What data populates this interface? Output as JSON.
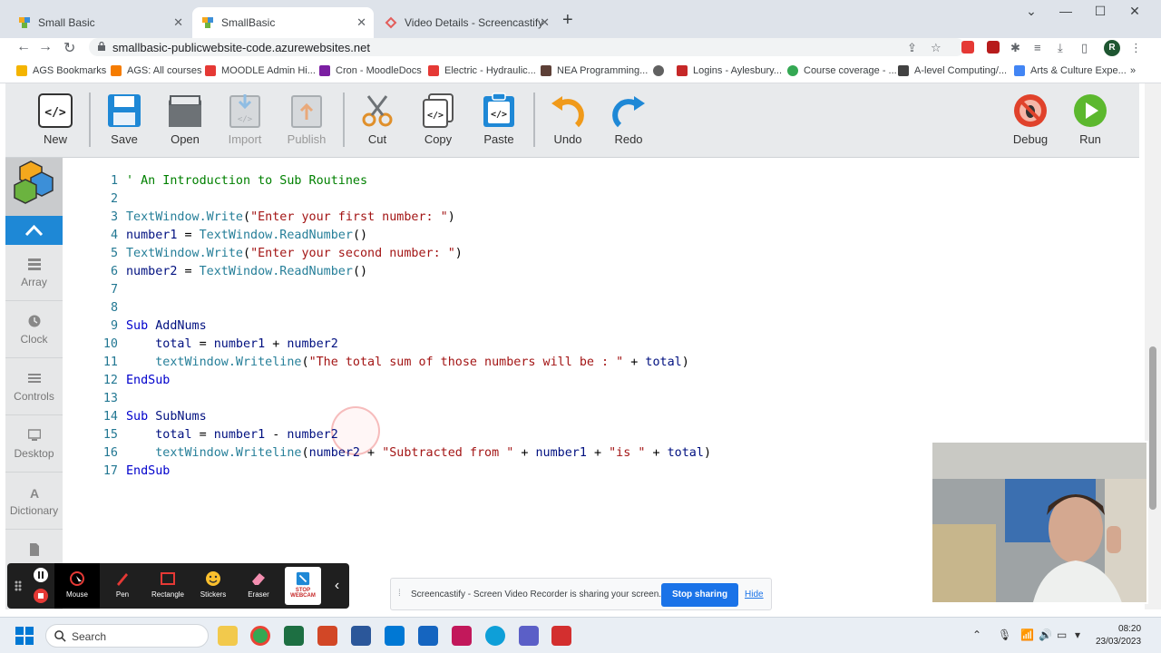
{
  "browser": {
    "tabs": [
      {
        "title": "Small Basic",
        "active": false
      },
      {
        "title": "SmallBasic",
        "active": true
      },
      {
        "title": "Video Details - Screencastify",
        "active": false
      }
    ],
    "url": "smallbasic-publicwebsite-code.azurewebsites.net",
    "profile_initial": "R",
    "bookmarks": [
      "AGS Bookmarks",
      "AGS: All courses",
      "MOODLE Admin Hi...",
      "Cron - MoodleDocs",
      "Electric - Hydraulic...",
      "NEA Programming...",
      "Logins - Aylesbury...",
      "Course coverage - ...",
      "A-level Computing/...",
      "Arts & Culture Expe..."
    ]
  },
  "ribbon": {
    "new": "New",
    "save": "Save",
    "open": "Open",
    "import": "Import",
    "publish": "Publish",
    "cut": "Cut",
    "copy": "Copy",
    "paste": "Paste",
    "undo": "Undo",
    "redo": "Redo",
    "debug": "Debug",
    "run": "Run"
  },
  "sidebar": {
    "items": [
      "Array",
      "Clock",
      "Controls",
      "Desktop",
      "Dictionary"
    ]
  },
  "editor": {
    "lines": [
      {
        "n": "1",
        "tokens": [
          [
            "t-comment",
            "' An Introduction to Sub Routines"
          ]
        ]
      },
      {
        "n": "2",
        "tokens": []
      },
      {
        "n": "3",
        "tokens": [
          [
            "t-obj",
            "TextWindow.Write"
          ],
          [
            "t-txt",
            "("
          ],
          [
            "t-str",
            "\"Enter your first number: \""
          ],
          [
            "t-txt",
            ")"
          ]
        ]
      },
      {
        "n": "4",
        "tokens": [
          [
            "t-var",
            "number1"
          ],
          [
            "t-txt",
            " = "
          ],
          [
            "t-obj",
            "TextWindow.ReadNumber"
          ],
          [
            "t-txt",
            "()"
          ]
        ]
      },
      {
        "n": "5",
        "tokens": [
          [
            "t-obj",
            "TextWindow.Write"
          ],
          [
            "t-txt",
            "("
          ],
          [
            "t-str",
            "\"Enter your second number: \""
          ],
          [
            "t-txt",
            ")"
          ]
        ]
      },
      {
        "n": "6",
        "tokens": [
          [
            "t-var",
            "number2"
          ],
          [
            "t-txt",
            " = "
          ],
          [
            "t-obj",
            "TextWindow.ReadNumber"
          ],
          [
            "t-txt",
            "()"
          ]
        ]
      },
      {
        "n": "7",
        "tokens": []
      },
      {
        "n": "8",
        "tokens": []
      },
      {
        "n": "9",
        "tokens": [
          [
            "t-kw",
            "Sub"
          ],
          [
            "t-txt",
            " "
          ],
          [
            "t-var",
            "AddNums"
          ]
        ]
      },
      {
        "n": "10",
        "tokens": [
          [
            "t-txt",
            "    "
          ],
          [
            "t-var",
            "total"
          ],
          [
            "t-txt",
            " = "
          ],
          [
            "t-var",
            "number1"
          ],
          [
            "t-txt",
            " + "
          ],
          [
            "t-var",
            "number2"
          ]
        ]
      },
      {
        "n": "11",
        "tokens": [
          [
            "t-txt",
            "    "
          ],
          [
            "t-obj",
            "textWindow.Writeline"
          ],
          [
            "t-txt",
            "("
          ],
          [
            "t-str",
            "\"The total sum of those numbers will be : \""
          ],
          [
            "t-txt",
            " + "
          ],
          [
            "t-var",
            "total"
          ],
          [
            "t-txt",
            ")"
          ]
        ]
      },
      {
        "n": "12",
        "tokens": [
          [
            "t-kw",
            "EndSub"
          ]
        ]
      },
      {
        "n": "13",
        "tokens": []
      },
      {
        "n": "14",
        "tokens": [
          [
            "t-kw",
            "Sub"
          ],
          [
            "t-txt",
            " "
          ],
          [
            "t-var",
            "SubNums"
          ]
        ]
      },
      {
        "n": "15",
        "tokens": [
          [
            "t-txt",
            "    "
          ],
          [
            "t-var",
            "total"
          ],
          [
            "t-txt",
            " = "
          ],
          [
            "t-var",
            "number1"
          ],
          [
            "t-txt",
            " - "
          ],
          [
            "t-var",
            "number2"
          ]
        ]
      },
      {
        "n": "16",
        "tokens": [
          [
            "t-txt",
            "    "
          ],
          [
            "t-obj",
            "textWindow.Writeline"
          ],
          [
            "t-txt",
            "("
          ],
          [
            "t-var",
            "number2"
          ],
          [
            "t-txt",
            " + "
          ],
          [
            "t-str",
            "\"Subtracted from \""
          ],
          [
            "t-txt",
            " + "
          ],
          [
            "t-var",
            "number1"
          ],
          [
            "t-txt",
            " + "
          ],
          [
            "t-str",
            "\"is \""
          ],
          [
            "t-txt",
            " + "
          ],
          [
            "t-var",
            "total"
          ],
          [
            "t-txt",
            ")"
          ]
        ]
      },
      {
        "n": "17",
        "tokens": [
          [
            "t-kw",
            "EndSub"
          ]
        ]
      }
    ]
  },
  "screencastify": {
    "tools": [
      "Mouse",
      "Pen",
      "Rectangle",
      "Stickers",
      "Eraser"
    ],
    "webcam_label": "STOP WEBCAM",
    "share_message": "Screencastify - Screen Video Recorder is sharing your screen.",
    "stop_sharing": "Stop sharing",
    "hide": "Hide"
  },
  "taskbar": {
    "search_placeholder": "Search",
    "time": "08:20",
    "date": "23/03/2023"
  },
  "colors": {
    "accent": "#1e88d6",
    "run_green": "#5cb82e",
    "debug_red": "#e0422b"
  }
}
